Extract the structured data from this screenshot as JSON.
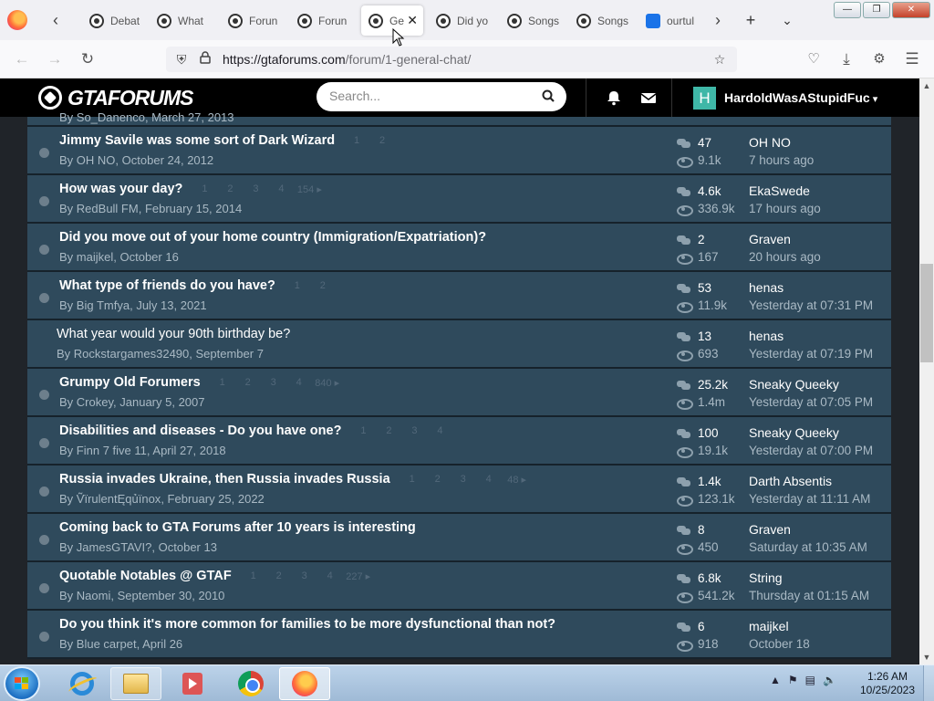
{
  "browser": {
    "tabs": [
      {
        "label": "Debat",
        "active": false
      },
      {
        "label": "What",
        "active": false
      },
      {
        "label": "Forun",
        "active": false
      },
      {
        "label": "Forun",
        "active": false
      },
      {
        "label": "Ge",
        "active": true
      },
      {
        "label": "Did yo",
        "active": false
      },
      {
        "label": "Songs",
        "active": false
      },
      {
        "label": "Songs",
        "active": false
      },
      {
        "label": "ourtul",
        "active": false
      }
    ],
    "url_host": "https://gtaforums.com",
    "url_path": "/forum/1-general-chat/"
  },
  "site": {
    "logo_text": "GTAFORUMS",
    "search_placeholder": "Search...",
    "avatar_letter": "H",
    "username": "HardoldWasAStupidFuc"
  },
  "partial_row": {
    "byline": "By So_Danenco, March 27, 2013"
  },
  "topics": [
    {
      "title": "Jimmy Savile was some sort of Dark Wizard",
      "author": "OH NO",
      "date": "October 24, 2012",
      "pages": [
        "1",
        "2"
      ],
      "replies": "47",
      "views": "9.1k",
      "last_user": "OH NO",
      "last_time": "7 hours ago",
      "unread": true
    },
    {
      "title": "How was your day?",
      "author": "RedBull FM",
      "date": "February 15, 2014",
      "pages": [
        "1",
        "2",
        "3",
        "4",
        "154 ▸"
      ],
      "replies": "4.6k",
      "views": "336.9k",
      "last_user": "EkaSwede",
      "last_time": "17 hours ago",
      "unread": true
    },
    {
      "title": "Did you move out of your home country (Immigration/Expatriation)?",
      "author": "maijkel",
      "date": "October 16",
      "pages": [],
      "replies": "2",
      "views": "167",
      "last_user": "Graven",
      "last_time": "20 hours ago",
      "unread": true
    },
    {
      "title": "What type of friends do you have?",
      "author": "Big Tmfya",
      "date": "July 13, 2021",
      "pages": [
        "1",
        "2"
      ],
      "replies": "53",
      "views": "11.9k",
      "last_user": "henas",
      "last_time": "Yesterday at 07:31 PM",
      "unread": true
    },
    {
      "title": "What year would your 90th birthday be?",
      "author": "Rockstargames32490",
      "date": "September 7",
      "pages": [],
      "replies": "13",
      "views": "693",
      "last_user": "henas",
      "last_time": "Yesterday at 07:19 PM",
      "unread": false
    },
    {
      "title": "Grumpy Old Forumers",
      "author": "Crokey",
      "date": "January 5, 2007",
      "pages": [
        "1",
        "2",
        "3",
        "4",
        "840 ▸"
      ],
      "replies": "25.2k",
      "views": "1.4m",
      "last_user": "Sneaky Queeky",
      "last_time": "Yesterday at 07:05 PM",
      "unread": true
    },
    {
      "title": "Disabilities and diseases - Do you have one?",
      "author": "Finn 7 five 11",
      "date": "April 27, 2018",
      "pages": [
        "1",
        "2",
        "3",
        "4"
      ],
      "replies": "100",
      "views": "19.1k",
      "last_user": "Sneaky Queeky",
      "last_time": "Yesterday at 07:00 PM",
      "unread": true
    },
    {
      "title": "Russia invades Ukraine, then Russia invades Russia",
      "author": "ṼïrulentĘqủïnox",
      "date": "February 25, 2022",
      "pages": [
        "1",
        "2",
        "3",
        "4",
        "48 ▸"
      ],
      "replies": "1.4k",
      "views": "123.1k",
      "last_user": "Darth Absentis",
      "last_time": "Yesterday at 11:11 AM",
      "unread": true
    },
    {
      "title": "Coming back to GTA Forums after 10 years is interesting",
      "author": "JamesGTAVI?",
      "date": "October 13",
      "pages": [],
      "replies": "8",
      "views": "450",
      "last_user": "Graven",
      "last_time": "Saturday at 10:35 AM",
      "unread": true
    },
    {
      "title": "Quotable Notables @ GTAF",
      "author": "Naomi",
      "date": "September 30, 2010",
      "pages": [
        "1",
        "2",
        "3",
        "4",
        "227 ▸"
      ],
      "replies": "6.8k",
      "views": "541.2k",
      "last_user": "String",
      "last_time": "Thursday at 01:15 AM",
      "unread": true
    },
    {
      "title": "Do you think it's more common for families to be more dysfunctional than not?",
      "author": "Blue carpet",
      "date": "April 26",
      "pages": [],
      "replies": "6",
      "views": "918",
      "last_user": "maijkel",
      "last_time": "October 18",
      "unread": true
    }
  ],
  "taskbar": {
    "time": "1:26 AM",
    "date": "10/25/2023"
  },
  "colors": {
    "row_bg": "#2f4a5c",
    "page_bg": "#202429",
    "header_bg": "#000000"
  }
}
